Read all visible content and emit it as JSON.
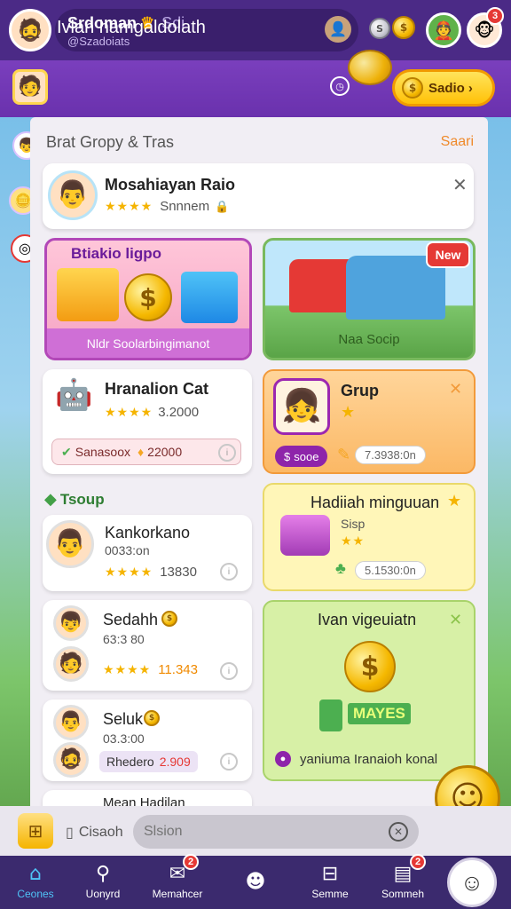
{
  "header": {
    "user_name": "Srdoman",
    "user_suffix": "Sdi",
    "user_sub": "@Szadoiats",
    "notif_count": "3"
  },
  "subbar": {
    "title": "Ivlan hamgaldolath",
    "cta_label": "Sadio"
  },
  "panel": {
    "title": "Brat Gropy & Tras",
    "link": "Saari"
  },
  "top_card": {
    "title": "Mosahiayan Raio",
    "stars": "★★★★",
    "meta": "Snnnem"
  },
  "promo_left": {
    "title": "Btiakio ligpo",
    "caption": "Nldr Soolarbingimanot"
  },
  "promo_right": {
    "badge": "New",
    "caption": "Naa Socip"
  },
  "card_a": {
    "title": "Hranalion Cat",
    "stars": "★★★★",
    "meta": "3.2000",
    "pill": "Sanasoox",
    "pill_value": "22000"
  },
  "card_b": {
    "title": "Grup",
    "chip": "sooe",
    "value": "7.3938:0n"
  },
  "section": {
    "label": "Tsoup"
  },
  "card_c": {
    "name": "Kankorkano",
    "sub": "0033:on",
    "stars": "★★★★",
    "meta": "13830"
  },
  "card_d": {
    "title": "Hadiiah minguuan",
    "sub": "Sisp",
    "value": "5.1530:0n"
  },
  "card_e": {
    "name": "Sedahh",
    "sub": "63:3 80",
    "stars": "★★★★",
    "meta": "11.343"
  },
  "card_f": {
    "title": "Ivan vigeuiatn",
    "banner": "MAYES",
    "footer": "yaniuma Iranaioh konal"
  },
  "card_g": {
    "name": "Seluk",
    "sub": "03.3:00",
    "tag": "Rhedero",
    "tag_value": "2.909"
  },
  "card_h": {
    "name": "Mean Hadilan"
  },
  "search": {
    "label": "Cisaoh",
    "placeholder": "Slsion"
  },
  "nav": [
    {
      "label": "Ceones",
      "icon": "home-icon",
      "active": true
    },
    {
      "label": "Uonyrd",
      "icon": "search-icon"
    },
    {
      "label": "Memahcer",
      "icon": "chat-icon",
      "badge": "2"
    },
    {
      "label": "",
      "icon": "profile-icon"
    },
    {
      "label": "Semme",
      "icon": "gift-icon"
    },
    {
      "label": "Sommeh",
      "icon": "inbox-icon",
      "badge": "2"
    }
  ],
  "colors": {
    "brand_purple": "#4b2a86",
    "accent_gold": "#ffc107",
    "danger_red": "#e53935",
    "promo_green": "#7cc56a"
  }
}
